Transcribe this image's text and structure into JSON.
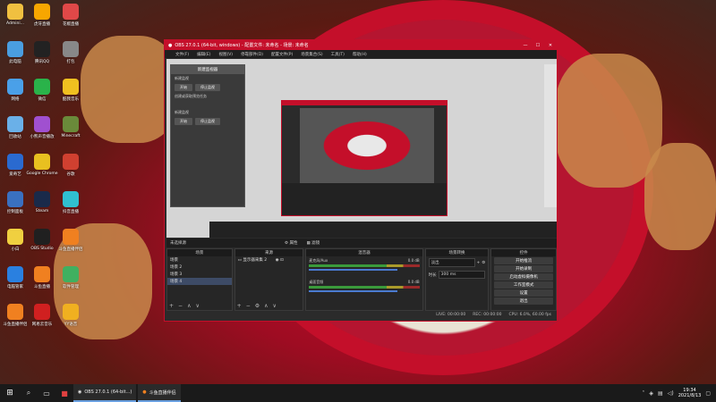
{
  "desktop": {
    "icons": [
      {
        "label": "Admini...",
        "color": "#f0c040"
      },
      {
        "label": "虎牙直播",
        "color": "#f7a600"
      },
      {
        "label": "花椒直播",
        "color": "#e04848"
      },
      {
        "label": "此电脑",
        "color": "#4a9ee0"
      },
      {
        "label": "腾讯QQ",
        "color": "#222222"
      },
      {
        "label": "打包",
        "color": "#888888"
      },
      {
        "label": "网络",
        "color": "#4aa0e8"
      },
      {
        "label": "微信",
        "color": "#2ab34a"
      },
      {
        "label": "酷我音乐",
        "color": "#f0c020"
      },
      {
        "label": "回收站",
        "color": "#6ab0e8"
      },
      {
        "label": "小熊声音播放",
        "color": "#a050d0"
      },
      {
        "label": "Minecraft",
        "color": "#6a8a3a"
      },
      {
        "label": "爱奇艺",
        "color": "#2a6ad0"
      },
      {
        "label": "Google Chrome",
        "color": "#e8c020"
      },
      {
        "label": "谷歌",
        "color": "#d04030"
      },
      {
        "label": "控制面板",
        "color": "#3a70c0"
      },
      {
        "label": "Steam",
        "color": "#1a2a4a"
      },
      {
        "label": "抖音直播",
        "color": "#30c0d0"
      },
      {
        "label": "小白",
        "color": "#f0d040"
      },
      {
        "label": "OBS Studio",
        "color": "#202020"
      },
      {
        "label": "斗鱼直播伴侣",
        "color": "#f08020"
      },
      {
        "label": "电脑管家",
        "color": "#2a80e0"
      },
      {
        "label": "斗鱼直播",
        "color": "#f08020"
      },
      {
        "label": "软件管理",
        "color": "#40b060"
      },
      {
        "label": "斗鱼直播伴侣",
        "color": "#f08020"
      },
      {
        "label": "网易云音乐",
        "color": "#d02020"
      },
      {
        "label": "YY语音",
        "color": "#f0b020"
      }
    ]
  },
  "obs": {
    "title": "OBS 27.0.1 (64-bit, windows) - 配置文件: 未命名 - 场景: 未命名",
    "win_controls": [
      "—",
      "☐",
      "✕"
    ],
    "menu": [
      "文件(F)",
      "编辑(E)",
      "视图(V)",
      "停靠部件(D)",
      "配置文件(P)",
      "场景集合(S)",
      "工具(T)",
      "帮助(H)"
    ],
    "cast_tool": {
      "header": "新建监视器",
      "sec1": "新建监视",
      "sec1_btns": [
        "开始",
        "停止监视"
      ],
      "note": "创建或获取预览任务",
      "sec2": "新建监视",
      "sec2_btns": [
        "开始",
        "停止监视"
      ]
    },
    "transitions_bar": {
      "left": "未选择源",
      "props": "属性",
      "filters": "滤镜"
    },
    "scenes": {
      "header": "场景",
      "items": [
        "场景",
        "场景 2",
        "场景 3",
        "场景 4"
      ],
      "selected": 3
    },
    "sources": {
      "header": "来源",
      "items": [
        "显示器采集 2"
      ]
    },
    "mixer": {
      "header": "混音器",
      "tracks": [
        {
          "name": "麦克风/Aux",
          "db": "0.0 dB",
          "level": 0.7
        },
        {
          "name": "桌面音频",
          "db": "0.0 dB",
          "level": 0.6
        }
      ]
    },
    "transitions": {
      "header": "场景转换",
      "type": "淡出",
      "duration_label": "时长",
      "duration": "300 ms"
    },
    "controls": {
      "header": "控件",
      "buttons": [
        "开始推流",
        "开始录制",
        "启动虚拟摄像机",
        "工作室模式",
        "设置",
        "退出"
      ]
    },
    "status": {
      "live": "LIVE: 00:00:00",
      "rec": "REC: 00:00:00",
      "cpu": "CPU: 6.0%, 60.00 fps"
    }
  },
  "taskbar": {
    "apps": [
      {
        "label": "OBS 27.0.1 (64-bit...)"
      },
      {
        "label": "斗鱼直播伴侣"
      }
    ],
    "time": "19:34",
    "date": "2021/8/13"
  }
}
